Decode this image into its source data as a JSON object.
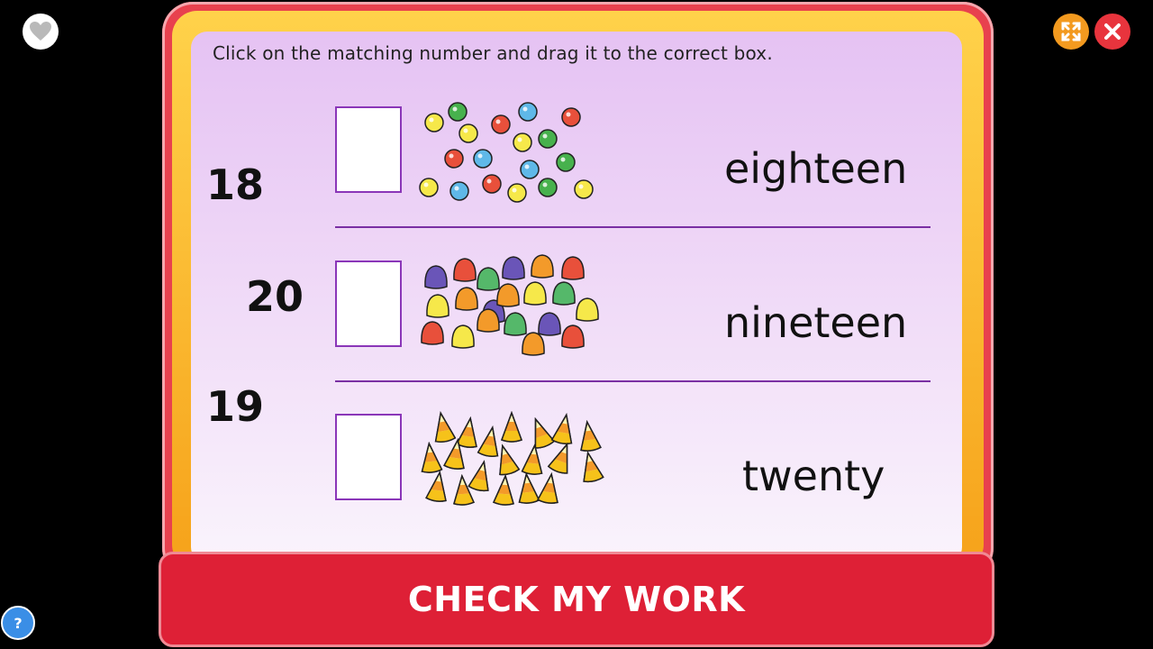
{
  "instruction": "Click on the matching number and drag it to the correct box.",
  "number_tiles": [
    "18",
    "20",
    "19"
  ],
  "rows": [
    {
      "word": "eighteen",
      "items": "gumballs",
      "count": 18
    },
    {
      "word": "nineteen",
      "items": "gumdrops",
      "count": 20
    },
    {
      "word": "twenty",
      "items": "candy-corn",
      "count": 19
    }
  ],
  "check_button": "CHECK MY WORK",
  "help_label": "?",
  "colors": {
    "frame_red": "#e8414e",
    "frame_gold": "#f6a21a",
    "button_red": "#de2036",
    "panel_purple": "#e5c2f3",
    "divider": "#7a2fa3"
  }
}
